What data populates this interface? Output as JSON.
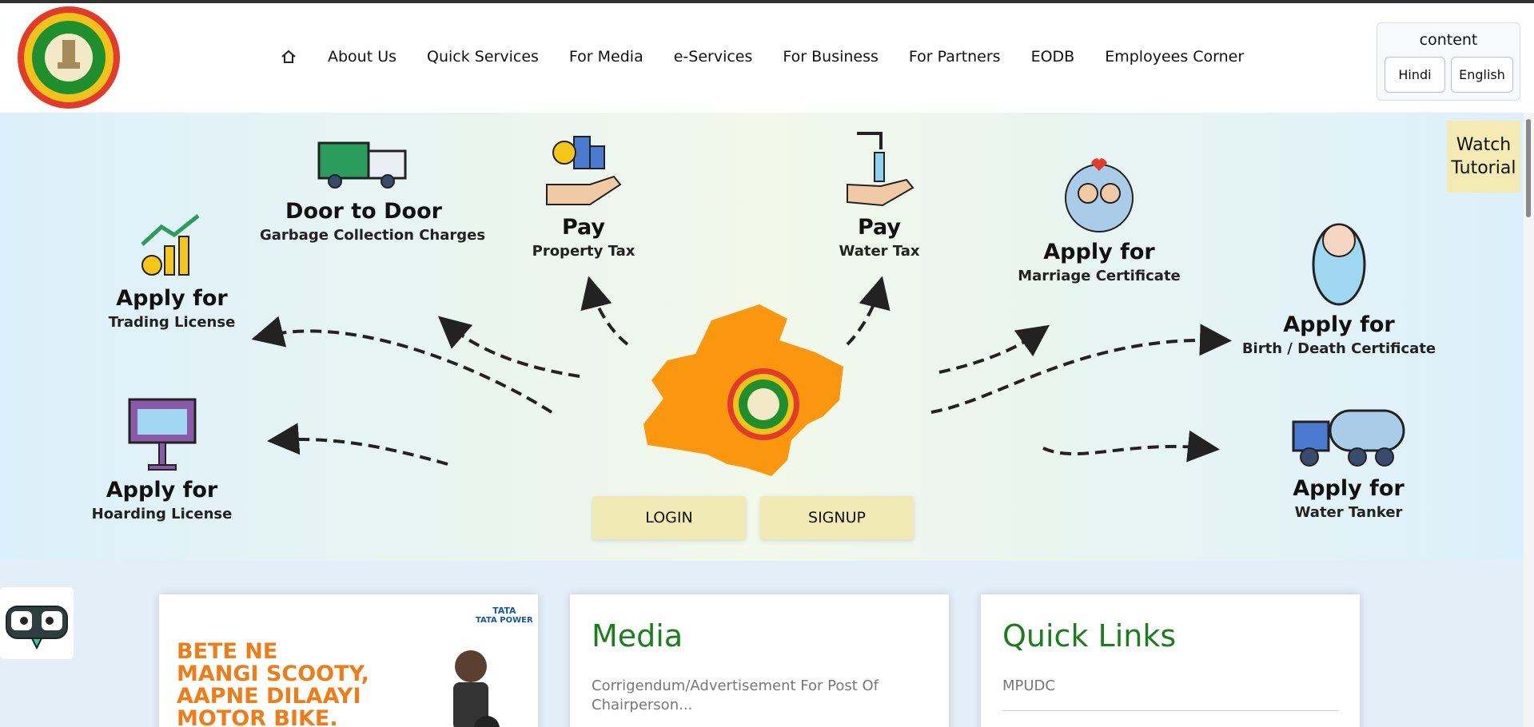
{
  "header": {
    "nav": [
      {
        "label": "About Us"
      },
      {
        "label": "Quick Services"
      },
      {
        "label": "For Media"
      },
      {
        "label": "e-Services"
      },
      {
        "label": "For Business"
      },
      {
        "label": "For Partners"
      },
      {
        "label": "EODB"
      },
      {
        "label": "Employees Corner"
      }
    ],
    "language": {
      "title": "content",
      "hindi": "Hindi",
      "english": "English"
    }
  },
  "hero": {
    "watch_tutorial": "Watch Tutorial",
    "login": "LOGIN",
    "signup": "SIGNUP",
    "services": [
      {
        "title": "Door to Door",
        "subtitle": "Garbage Collection Charges",
        "icon": "garbage-truck-icon"
      },
      {
        "title": "Pay",
        "subtitle": "Property Tax",
        "icon": "property-tax-icon"
      },
      {
        "title": "Pay",
        "subtitle": "Water Tax",
        "icon": "water-tax-icon"
      },
      {
        "title": "Apply for",
        "subtitle": "Marriage Certificate",
        "icon": "couple-icon"
      },
      {
        "title": "Apply for",
        "subtitle": "Trading License",
        "icon": "growth-chart-icon"
      },
      {
        "title": "Apply for",
        "subtitle": "Birth / Death Certificate",
        "icon": "baby-icon"
      },
      {
        "title": "Apply for",
        "subtitle": "Hoarding License",
        "icon": "billboard-icon"
      },
      {
        "title": "Apply for",
        "subtitle": "Water Tanker",
        "icon": "water-tanker-icon"
      }
    ]
  },
  "cards": {
    "ad": {
      "lines": [
        "BETE NE",
        "MANGI SCOOTY,",
        "AAPNE DILAAYI",
        "MOTOR BIKE."
      ],
      "brand": "TATA",
      "brand_sub": "TATA POWER"
    },
    "media": {
      "title": "Media",
      "item": "Corrigendum/Advertisement For Post Of Chairperson..."
    },
    "quick_links": {
      "title": "Quick Links",
      "item": "MPUDC"
    }
  },
  "colors": {
    "accent_green": "#1b7d1b",
    "button_yellow": "#f1eab7",
    "map_orange": "#fb970f",
    "ad_orange": "#f07c17"
  }
}
